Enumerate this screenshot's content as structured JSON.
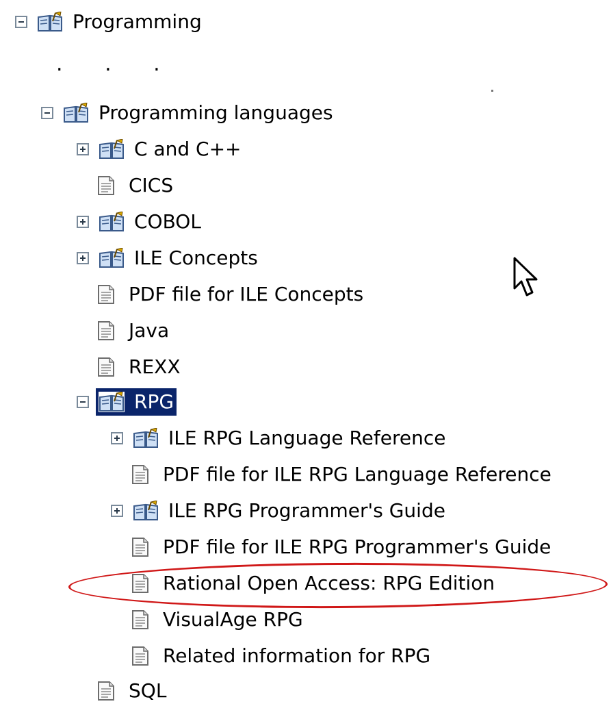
{
  "tree": {
    "root": {
      "label": "Programming",
      "expanded": true
    },
    "ellipsis": ". . .",
    "items": [
      {
        "label": "Programming languages",
        "type": "book",
        "expanded": true
      },
      {
        "label": "C and C++",
        "type": "book",
        "expanded": false
      },
      {
        "label": "CICS",
        "type": "page"
      },
      {
        "label": "COBOL",
        "type": "book",
        "expanded": false
      },
      {
        "label": "ILE Concepts",
        "type": "book",
        "expanded": false
      },
      {
        "label": "PDF file for ILE Concepts",
        "type": "page"
      },
      {
        "label": "Java",
        "type": "page"
      },
      {
        "label": "REXX",
        "type": "page"
      },
      {
        "label": "RPG",
        "type": "book",
        "expanded": true,
        "selected": true
      },
      {
        "label": "ILE RPG Language Reference",
        "type": "book",
        "expanded": false
      },
      {
        "label": "PDF file for ILE RPG Language Reference",
        "type": "page"
      },
      {
        "label": "ILE RPG Programmer's Guide",
        "type": "book",
        "expanded": false
      },
      {
        "label": "PDF file for ILE RPG Programmer's Guide",
        "type": "page"
      },
      {
        "label": "Rational Open Access: RPG Edition",
        "type": "page",
        "highlighted": true
      },
      {
        "label": "VisualAge RPG",
        "type": "page"
      },
      {
        "label": "Related information for RPG",
        "type": "page"
      },
      {
        "label": "SQL",
        "type": "page"
      }
    ]
  },
  "colors": {
    "selection_bg": "#0a246a",
    "highlight_circle": "#d01818"
  }
}
